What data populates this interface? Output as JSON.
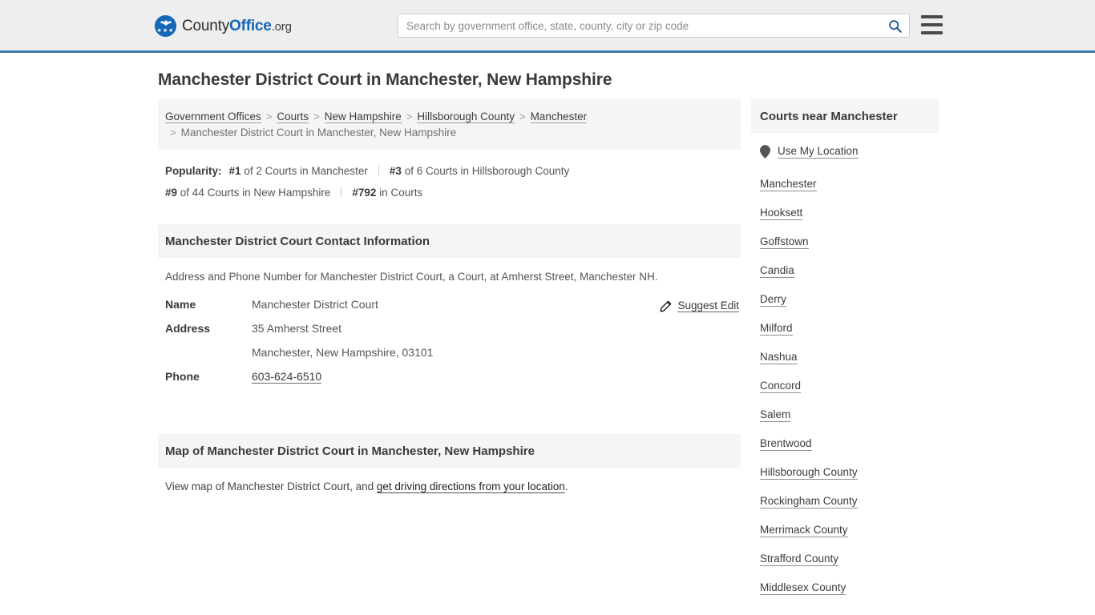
{
  "header": {
    "brand": {
      "part1": "County",
      "part2": "Office",
      "part3": ".org",
      "logo_icon": "eagle-shield-logo",
      "stars": "★★★"
    },
    "search": {
      "placeholder": "Search by government office, state, county, city or zip code",
      "value": "",
      "icon": "search-icon"
    },
    "menu_icon": "hamburger-menu-icon",
    "accent_color": "#1567b8",
    "border_color": "#3c78a8"
  },
  "page": {
    "title": "Manchester District Court in Manchester, New Hampshire"
  },
  "breadcrumb": {
    "separator": ">",
    "items": [
      {
        "label": "Government Offices",
        "current": false
      },
      {
        "label": "Courts",
        "current": false
      },
      {
        "label": "New Hampshire",
        "current": false
      },
      {
        "label": "Hillsborough County",
        "current": false
      },
      {
        "label": "Manchester",
        "current": false
      },
      {
        "label": "Manchester District Court in Manchester, New Hampshire",
        "current": true
      }
    ]
  },
  "popularity": {
    "label": "Popularity:",
    "items": [
      {
        "rank": "#1",
        "text": "of 2 Courts in Manchester"
      },
      {
        "rank": "#3",
        "text": "of 6 Courts in Hillsborough County"
      },
      {
        "rank": "#9",
        "text": "of 44 Courts in New Hampshire"
      },
      {
        "rank": "#792",
        "text": "in Courts"
      }
    ]
  },
  "contact": {
    "heading": "Manchester District Court Contact Information",
    "description": "Address and Phone Number for Manchester District Court, a Court, at Amherst Street, Manchester NH.",
    "suggest_edit": {
      "label": "Suggest Edit",
      "icon": "pencil-edit-icon"
    },
    "rows": [
      {
        "key": "Name",
        "value": "Manchester District Court",
        "link": false
      },
      {
        "key": "Address",
        "value": "35 Amherst Street",
        "link": false
      },
      {
        "key": "",
        "value": "Manchester, New Hampshire, 03101",
        "link": false
      },
      {
        "key": "Phone",
        "value": "603-624-6510",
        "link": true
      }
    ]
  },
  "map": {
    "heading": "Map of Manchester District Court in Manchester, New Hampshire",
    "desc_prefix": "View map of Manchester District Court, and ",
    "desc_link": "get driving directions from your location",
    "desc_suffix": "."
  },
  "sidebar": {
    "heading": "Courts near Manchester",
    "use_my_location": {
      "label": "Use My Location",
      "icon": "map-pin-icon"
    },
    "links": [
      "Manchester",
      "Hooksett",
      "Goffstown",
      "Candia",
      "Derry",
      "Milford",
      "Nashua",
      "Concord",
      "Salem",
      "Brentwood",
      "Hillsborough County",
      "Rockingham County",
      "Merrimack County",
      "Strafford County",
      "Middlesex County"
    ]
  }
}
